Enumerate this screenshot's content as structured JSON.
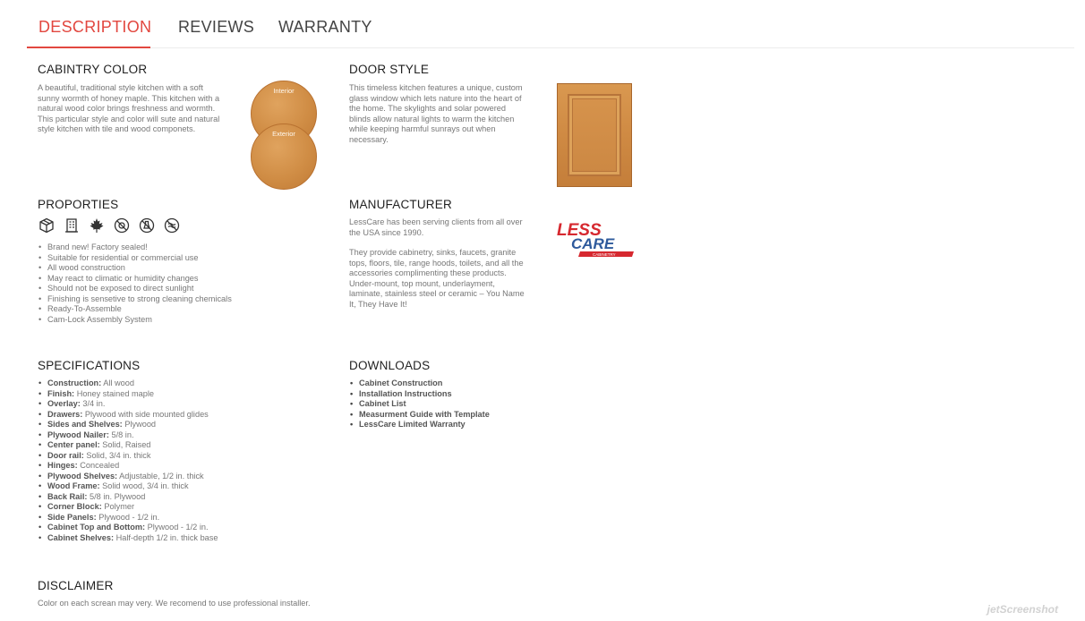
{
  "tabs": [
    {
      "label": "DESCRIPTION",
      "active": true
    },
    {
      "label": "REVIEWS",
      "active": false
    },
    {
      "label": "WARRANTY",
      "active": false
    }
  ],
  "cabinetry_color": {
    "title": "CABINTRY COLOR",
    "text": "A beautiful, traditional style kitchen with a soft sunny wormth of honey maple. This kitchen with a natural wood color brings freshness and wormth. This particular style and color will sute and natural style kitchen with tile and wood componets.",
    "swatch_interior": "Interior",
    "swatch_exterior": "Exterior"
  },
  "door_style": {
    "title": "DOOR STYLE",
    "text": "This timeless kitchen features a unique, custom glass window which lets nature into the heart of the home. The skylights and solar powered blinds allow natural lights to warm the kitchen while keeping harmful sunrays out when necessary."
  },
  "properties": {
    "title": "PROPORTIES",
    "icons": [
      "package-icon",
      "building-icon",
      "maple-leaf-icon",
      "no-sun-icon",
      "no-chemicals-icon",
      "no-humidity-icon"
    ],
    "items": [
      "Brand new! Factory sealed!",
      "Suitable for residential or commercial use",
      "All wood construction",
      "May react to climatic or humidity changes",
      "Should not be exposed to direct sunlight",
      "Finishing is sensetive to strong cleaning chemicals",
      "Ready-To-Assemble",
      "Cam-Lock Assembly System"
    ]
  },
  "manufacturer": {
    "title": "MANUFACTURER",
    "text1": "LessCare has been serving clients from all over the USA since 1990.",
    "text2": "They provide cabinetry, sinks, faucets, granite tops, floors, tile, range hoods, toilets, and all the accessories complimenting these products. Under-mount, top mount, underlayment, laminate, stainless steel or ceramic – You Name It, They Have It!",
    "logo_top": "LESS",
    "logo_bottom": "CARE",
    "logo_sub": "CABINETRY"
  },
  "specifications": {
    "title": "SPECIFICATIONS",
    "items": [
      {
        "label": "Construction:",
        "value": "All wood"
      },
      {
        "label": "Finish:",
        "value": "Honey stained maple"
      },
      {
        "label": "Overlay:",
        "value": "3/4 in."
      },
      {
        "label": "Drawers:",
        "value": "Plywood  with side mounted glides"
      },
      {
        "label": "Sides and Shelves:",
        "value": "Plywood"
      },
      {
        "label": "Plywood Nailer:",
        "value": "5/8 in."
      },
      {
        "label": "Center panel:",
        "value": "Solid, Raised"
      },
      {
        "label": "Door rail:",
        "value": "Solid, 3/4 in. thick"
      },
      {
        "label": "Hinges:",
        "value": "Concealed"
      },
      {
        "label": "Plywood Shelves:",
        "value": "Adjustable, 1/2 in. thick"
      },
      {
        "label": "Wood Frame:",
        "value": "Solid wood, 3/4 in. thick"
      },
      {
        "label": "Back Rail:",
        "value": "5/8 in. Plywood"
      },
      {
        "label": "Corner Block:",
        "value": "Polymer"
      },
      {
        "label": "Side Panels:",
        "value": "Plywood - 1/2 in."
      },
      {
        "label": "Cabinet Top and Bottom:",
        "value": "Plywood - 1/2 in."
      },
      {
        "label": "Cabinet Shelves:",
        "value": "Half-depth 1/2 in. thick base"
      }
    ]
  },
  "downloads": {
    "title": "DOWNLOADS",
    "items": [
      "Cabinet Construction",
      "Installation Instructions",
      "Cabinet List",
      "Measurment Guide with Template",
      "LessCare Limited Warranty"
    ]
  },
  "disclaimer": {
    "title": "DISCLAIMER",
    "text": "Color on each screan may very. We recomend to use professional installer."
  },
  "watermark": "jetScreenshot",
  "colors": {
    "accent": "#e2473f",
    "logo_blue": "#2e5a9c",
    "logo_red": "#d6282f"
  }
}
